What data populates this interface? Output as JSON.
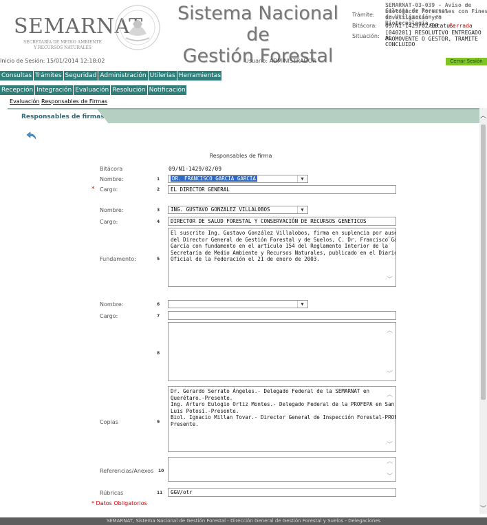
{
  "header": {
    "logo_text": "SEMARNAT",
    "logo_sub_1": "SECRETARÍA DE MEDIO AMBIENTE",
    "logo_sub_2": "Y RECURSOS NATURALES",
    "system_title_1": "Sistema Nacional de",
    "system_title_2": "Gestión Forestal",
    "info": {
      "tramite_label": "Trámite:",
      "tramite_value_1": "SEMARNAT-03-039 - Aviso de Colecta de Recursos",
      "tramite_value_2": "biológicos Forestales con Fines de Utilización en",
      "tramite_value_3": "investigación y/o Biotecnología.",
      "bitacora_label": "Bitácora:",
      "bitacora_value": "09/N1-1429/02/09",
      "estatus_label": "Estatus:",
      "estatus_value": "Cerrada",
      "situacion_label": "Situación:",
      "situacion_value_1": "[040201] RESOLUTIVO ENTREGADO AL",
      "situacion_value_2": "PROMOVENTE O GESTOR, TRAMITE CONCLUIDO"
    }
  },
  "session": {
    "start": "Inicio de Sesión: 15/01/2014 12:18:02",
    "user": "Usuario: ADMINISTRADOR",
    "logout": "Cerrar Sesión"
  },
  "menu1": [
    "Consultas",
    "Trámites",
    "Seguridad",
    "Administración",
    "Utilerías",
    "Herramientas"
  ],
  "menu2": [
    "Recepción",
    "Integración",
    "Evaluación",
    "Resolución",
    "Notificación"
  ],
  "breadcrumb": {
    "first": "Evaluación",
    "second": "Responsables de Firmas"
  },
  "tab": {
    "label": "Responsables de firmas"
  },
  "form": {
    "title": "Responsables de firma",
    "bitacora_label": "Bitácora",
    "bitacora_value": "09/N1-1429/02/09",
    "nombre_label": "Nombre:",
    "cargo_label": "Cargo:",
    "fundamento_label": "Fundamento:",
    "copias_label": "Copias",
    "referencias_label": "Referencias/Anexos",
    "rubricas_label": "Rúbricas",
    "required_mark": "*",
    "required_note": "* Datos Obligatorios",
    "numbers": [
      "1",
      "2",
      "3",
      "4",
      "5",
      "6",
      "7",
      "8",
      "9",
      "10",
      "11"
    ],
    "nombre1": "DR. FRANCISCO GARCÍA GARCÍA",
    "cargo1": "EL DIRECTOR GENERAL",
    "nombre2": "ING. GUSTAVO GONZALEZ VILLALOBOS",
    "cargo2": "DIRECTOR DE SALUD FORESTAL Y CONSERVACIÓN DE RECURSOS GENETICOS",
    "fundamento_lines": [
      "El suscrito Ing. Gustavo González Villalobos, firma en suplencia por ausencia",
      "del Director General de Gestión Forestal y de Suelos, C. Dr. Francisco García",
      "García con fundamento en el artículo 154 del Reglamento Interior de la",
      "Secretaría de Medio Ambiente y Recursos Naturales, publicado en el Diario",
      "Oficial de la Federación el 21 de enero de 2003."
    ],
    "nombre3": "",
    "cargo3": "",
    "copias_lines": [
      "Dr. Gerardo Serrato Ángeles.- Delegado Federal de la SEMARNAT en",
      "Querétaro.-Presente.",
      "Ing. Arturo Eulogio Ortiz Montes.- Delegado Federal de la  PROFEPA en San",
      "Luis Potosí.-Presente.",
      "Biol. Ignacio Millan Tovar.- Director General de Inspección Forestal-PROFEPA.-",
      "Presente."
    ],
    "rubricas_value": "GGV/otr"
  },
  "footer": "SEMARNAT, Sistema Nacional de Gestión Forestal - Dirección General de Gestión Forestal y Suelos - Delegaciones",
  "colors": {
    "menu_bg": "#2f7e7a",
    "logout_bg": "#7fc425",
    "tab_title": "#2a6b7c",
    "required": "#dd0000"
  }
}
